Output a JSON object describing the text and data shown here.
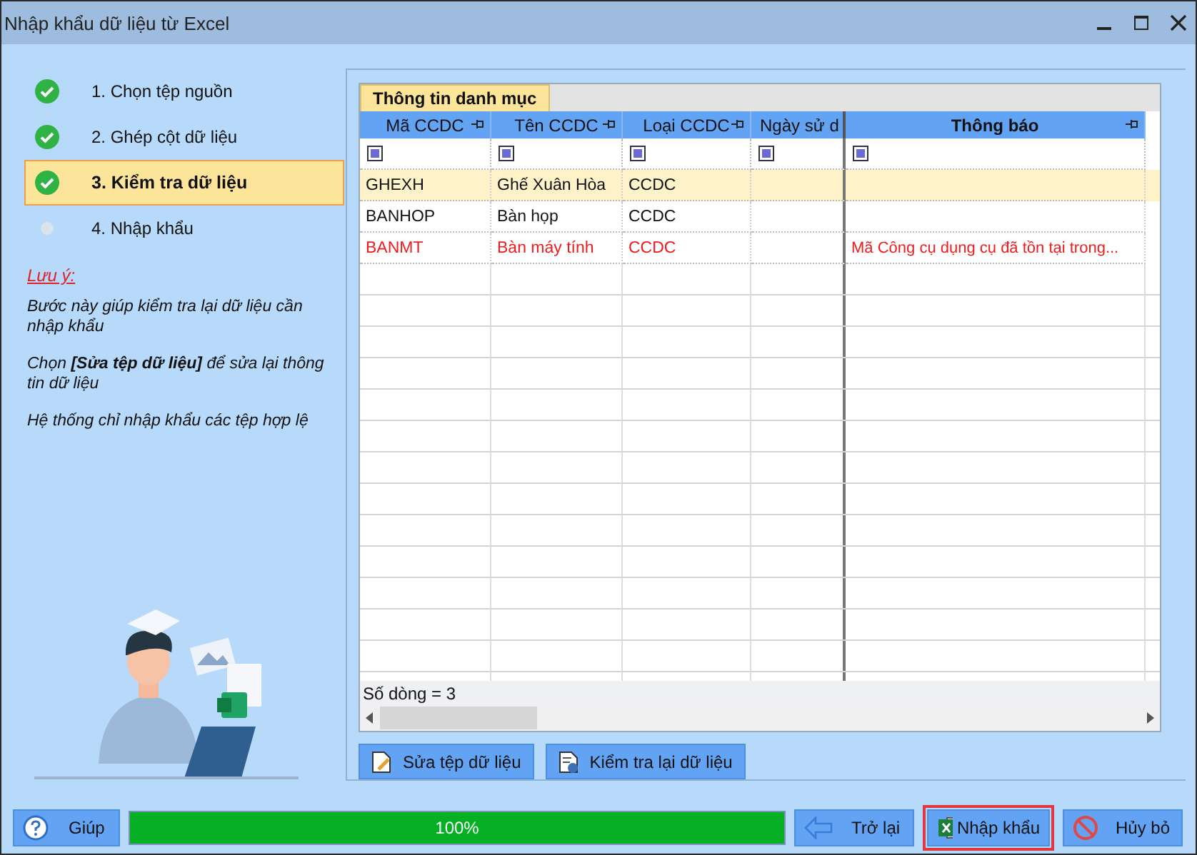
{
  "window": {
    "title": "Nhập khẩu dữ liệu từ Excel"
  },
  "steps": [
    {
      "label": "1. Chọn tệp nguồn",
      "done": true,
      "selected": false
    },
    {
      "label": "2. Ghép cột dữ liệu",
      "done": true,
      "selected": false
    },
    {
      "label": "3. Kiểm tra dữ liệu",
      "done": true,
      "selected": true
    },
    {
      "label": "4. Nhập khẩu",
      "done": false,
      "selected": false
    }
  ],
  "note": {
    "title": "Lưu ý:",
    "lines": [
      "Bước này giúp kiểm tra lại dữ liệu cần nhập khẩu",
      "Chọn **[Sửa tệp dữ liệu]** để sửa lại thông tin dữ liệu",
      "Hệ thống chỉ nhập khẩu các tệp hợp lệ"
    ]
  },
  "grid": {
    "tab": "Thông tin danh mục",
    "columns": [
      {
        "label": "Mã CCDC",
        "pinned": true,
        "bold": false
      },
      {
        "label": "Tên CCDC",
        "pinned": true,
        "bold": false
      },
      {
        "label": "Loại CCDC",
        "pinned": true,
        "bold": false
      },
      {
        "label": "Ngày sử d",
        "pinned": false,
        "bold": false
      },
      {
        "label": "Thông báo",
        "pinned": true,
        "bold": true
      }
    ],
    "rows": [
      {
        "cells": [
          "GHEXH",
          "Ghế Xuân Hòa",
          "CCDC",
          "",
          ""
        ],
        "selected": true,
        "error": false
      },
      {
        "cells": [
          "BANHOP",
          "Bàn họp",
          "CCDC",
          "",
          ""
        ],
        "selected": false,
        "error": false
      },
      {
        "cells": [
          "BANMT",
          "Bàn máy tính",
          "CCDC",
          "",
          "Mã Công cụ dụng cụ đã tồn tại trong..."
        ],
        "selected": false,
        "error": true
      }
    ],
    "footer": "Số dòng = 3"
  },
  "actions": [
    {
      "label": "Sửa tệp dữ liệu",
      "kind": "edit"
    },
    {
      "label": "Kiểm tra lại dữ liệu",
      "kind": "check"
    }
  ],
  "help": "Giúp",
  "progress": {
    "level": 1,
    "reading": "100%"
  },
  "nav": [
    {
      "label": "Trở lại",
      "kind": "back",
      "focused": false
    },
    {
      "label": "Nhập khẩu",
      "kind": "excel",
      "focused": true
    },
    {
      "label": "Hủy bỏ",
      "kind": "cancel",
      "focused": false
    }
  ]
}
